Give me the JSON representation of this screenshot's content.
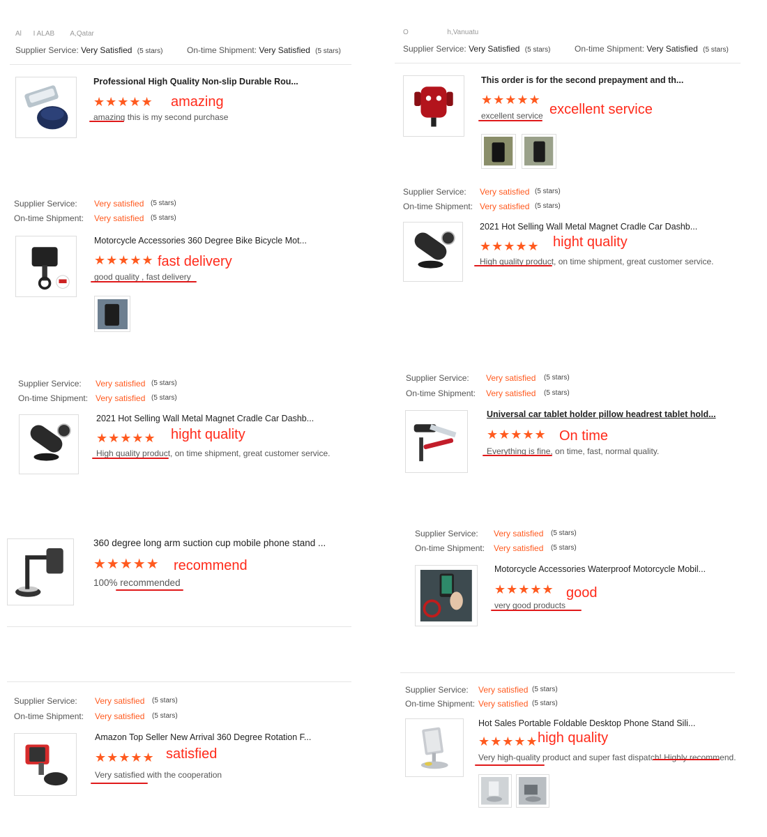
{
  "labels": {
    "supplier_service": "Supplier Service:",
    "on_time_shipment": "On-time Shipment:",
    "very_satisfied": "Very satisfied",
    "very_satisfied_cap": "Very Satisfied",
    "five_stars": "(5 stars)",
    "rating_stars": "★★★★★"
  },
  "left": {
    "reviewer": "Al   I ALAB    A,Qatar",
    "r1": {
      "title": "Professional High Quality Non-slip Durable Rou...",
      "tag": "amazing",
      "comment": "amazing this is my second purchase"
    },
    "r2": {
      "title": "Motorcycle Accessories 360 Degree Bike Bicycle Mot...",
      "tag": "fast delivery",
      "comment": "good quality , fast delivery"
    },
    "r3": {
      "title": "2021 Hot Selling Wall Metal Magnet Cradle Car Dashb...",
      "tag": "hight quality",
      "comment": "High quality product, on time shipment, great customer service."
    },
    "r4": {
      "title": "360 degree long arm suction cup mobile phone stand ...",
      "tag": "recommend",
      "comment": "100% recommended"
    },
    "r5": {
      "title": "Amazon Top Seller New Arrival 360 Degree Rotation F...",
      "tag": "satisfied",
      "comment": "Very satisfied with the cooperation"
    }
  },
  "right": {
    "reviewer": "O          h,Vanuatu",
    "r1": {
      "title": "This order is for the second prepayment and th...",
      "tag": "excellent service",
      "comment": "excellent service"
    },
    "r2": {
      "title": "2021 Hot Selling Wall Metal Magnet Cradle Car Dashb...",
      "tag": "hight quality",
      "comment": "High quality product, on time shipment, great customer service."
    },
    "r3": {
      "title": "Universal car tablet holder pillow headrest tablet hold...",
      "tag": "On time",
      "comment": "Everything is fine, on time, fast, normal quality."
    },
    "r4": {
      "title": "Motorcycle Accessories Waterproof Motorcycle Mobil...",
      "tag": "good",
      "comment": "very good products"
    },
    "r5": {
      "title": "Hot Sales Portable Foldable Desktop Phone Stand Sili...",
      "tag": "high quality",
      "comment": "Very high-quality product and super fast dispatch! Highly recommend."
    }
  }
}
